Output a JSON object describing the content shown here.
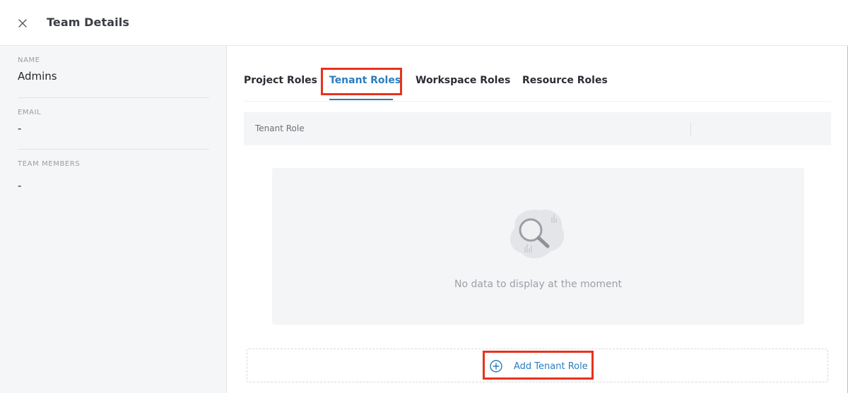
{
  "header": {
    "title": "Team Details",
    "close_icon": "close-icon"
  },
  "sidebar": {
    "fields": [
      {
        "label": "NAME",
        "value": "Admins"
      },
      {
        "label": "EMAIL",
        "value": "-"
      },
      {
        "label": "TEAM MEMBERS",
        "value": "-"
      }
    ]
  },
  "tabs": [
    {
      "label": "Project Roles",
      "active": false
    },
    {
      "label": "Tenant Roles",
      "active": true
    },
    {
      "label": "Workspace Roles",
      "active": false
    },
    {
      "label": "Resource Roles",
      "active": false
    }
  ],
  "table": {
    "columns": [
      "Tenant Role"
    ]
  },
  "empty_state": {
    "icon": "search-magnifier-icon",
    "message": "No data to display at the moment"
  },
  "add_button": {
    "label": "Add Tenant Role",
    "icon": "plus-circle-icon"
  },
  "colors": {
    "accent": "#2b7dbd",
    "highlight": "#e8321d",
    "sidebar_bg": "#f5f6f7"
  }
}
